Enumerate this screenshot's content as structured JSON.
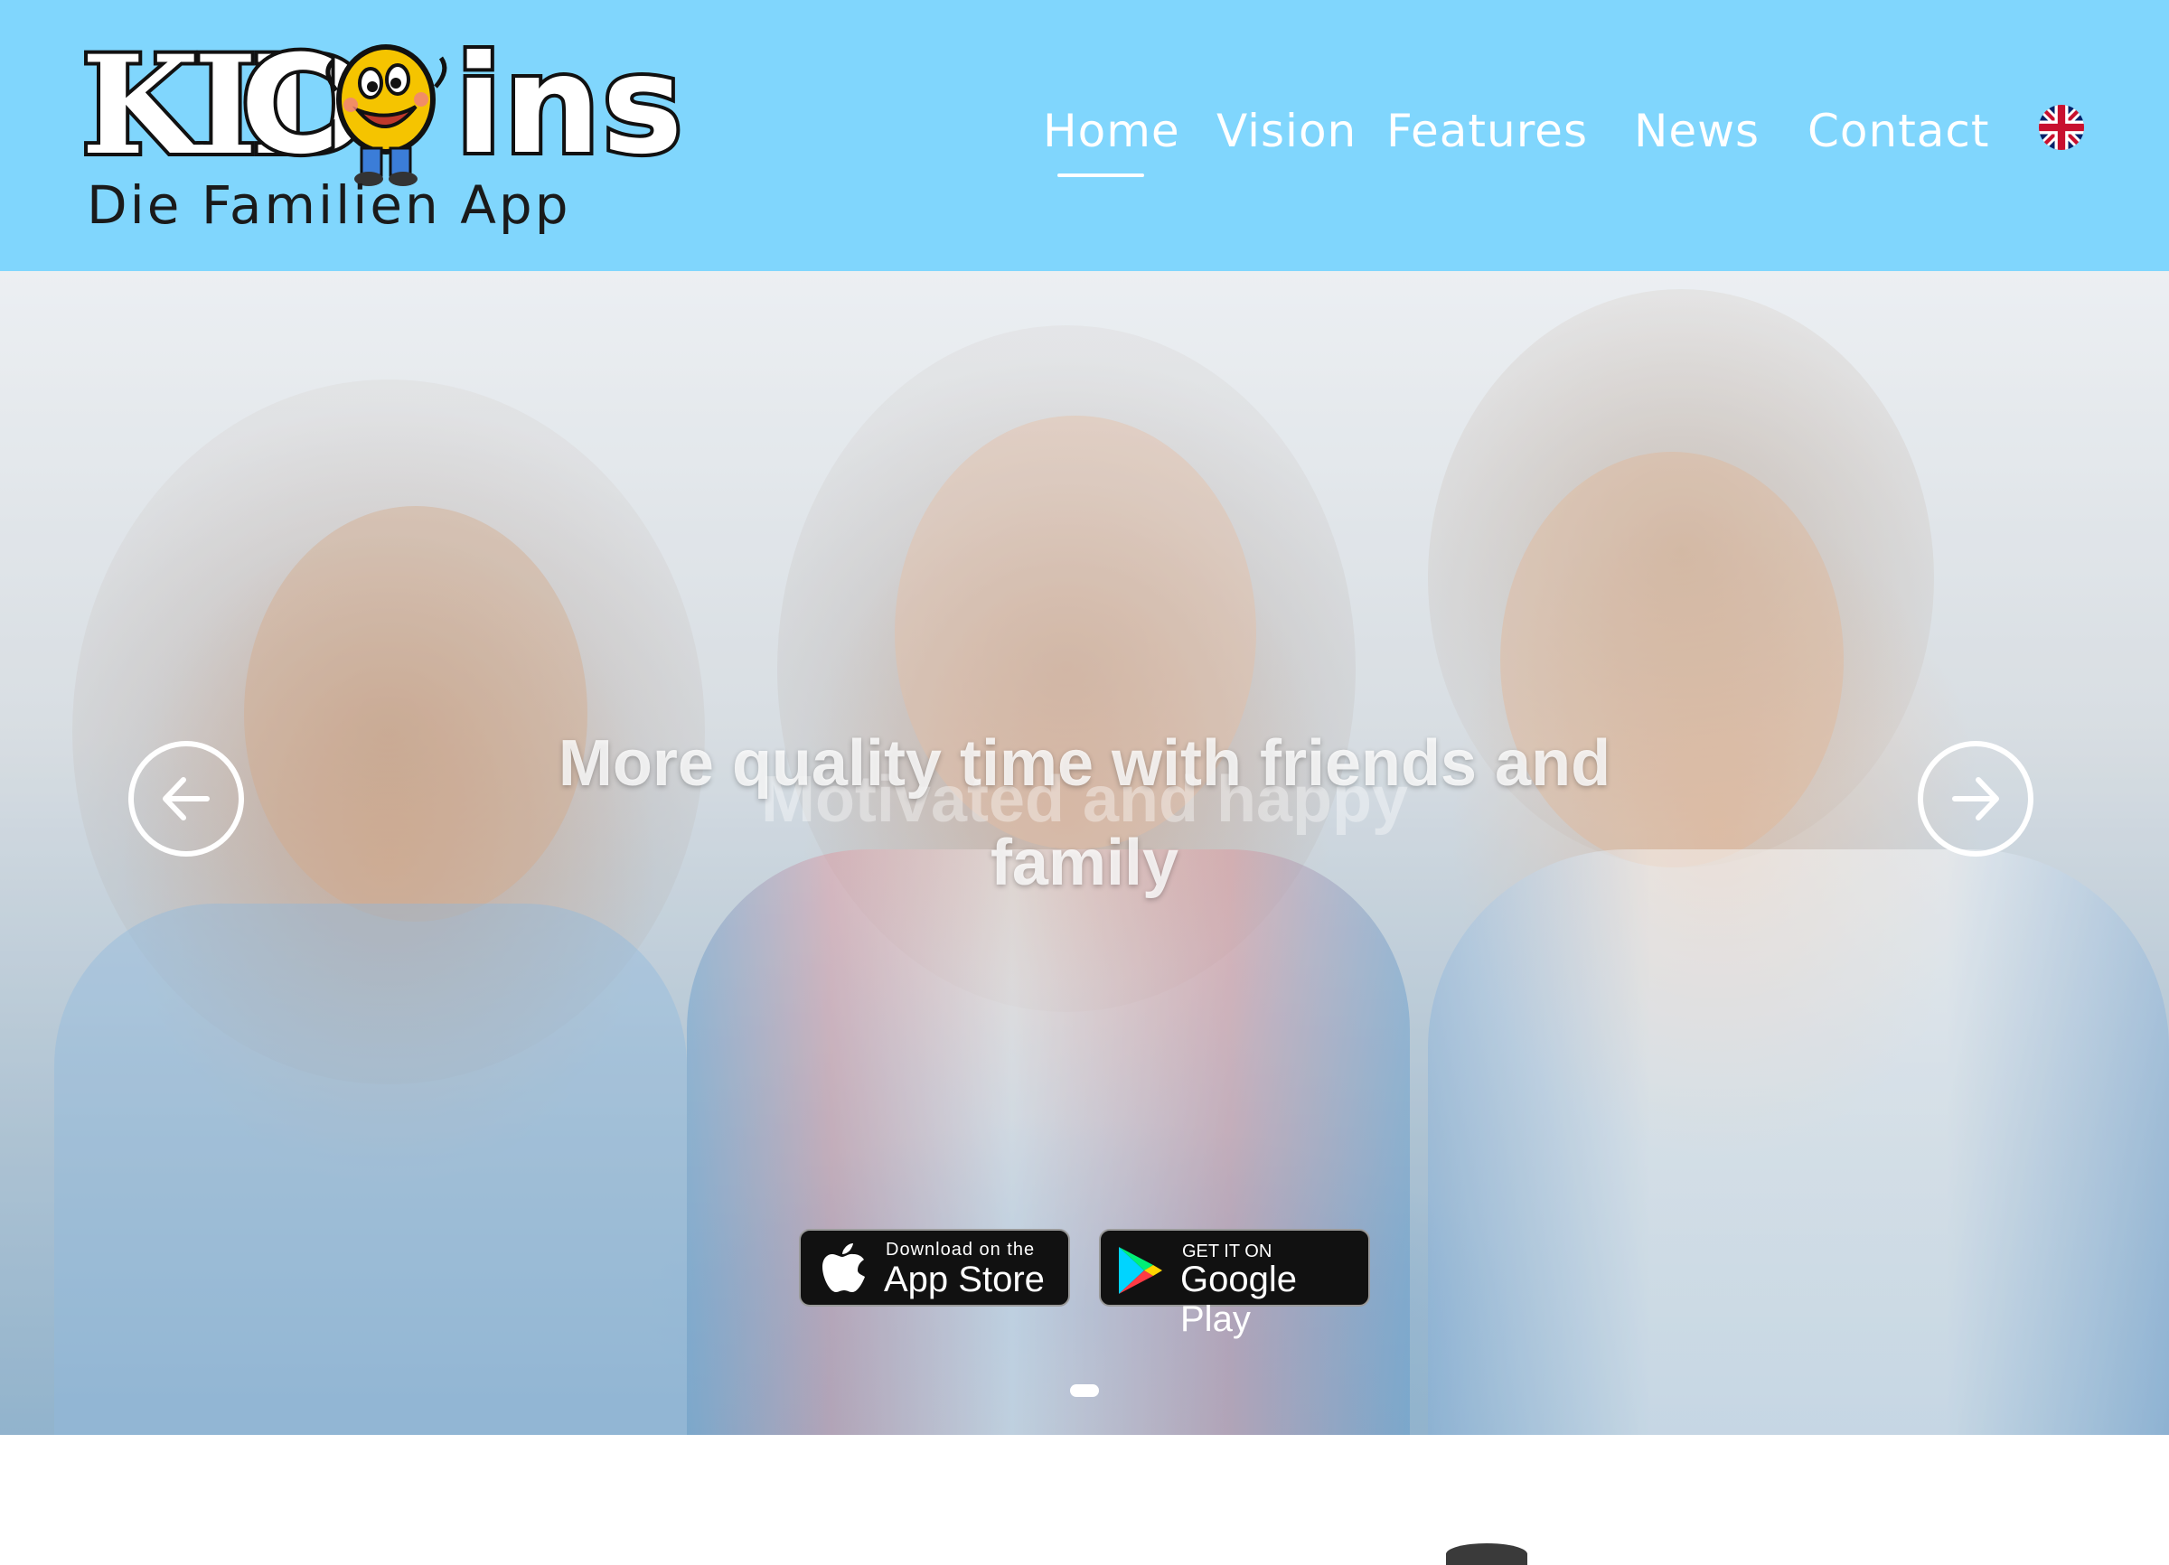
{
  "brand": {
    "logo_kid": "KID",
    "logo_c": "C",
    "logo_ins": "ins",
    "logo_subtitle": "Die Familien App"
  },
  "nav": {
    "items": [
      {
        "label": "Home",
        "active": true
      },
      {
        "label": "Vision",
        "active": false
      },
      {
        "label": "Features",
        "active": false
      },
      {
        "label": "News",
        "active": false
      },
      {
        "label": "Contact",
        "active": false
      }
    ],
    "language_icon": "uk-flag-icon"
  },
  "hero": {
    "title": "More quality time with friends and family",
    "subtitle": "Motivated and happy",
    "prev_icon": "arrow-left-icon",
    "next_icon": "arrow-right-icon",
    "slides_total": 1,
    "active_slide": 1
  },
  "stores": {
    "apple": {
      "small": "Download on the",
      "big": "App Store",
      "icon": "apple-icon"
    },
    "google": {
      "small": "GET IT ON",
      "big": "Google Play",
      "icon": "google-play-icon"
    }
  },
  "colors": {
    "header_bg": "#80d6fd",
    "nav_text": "#ffffff",
    "store_bg": "#111111"
  }
}
